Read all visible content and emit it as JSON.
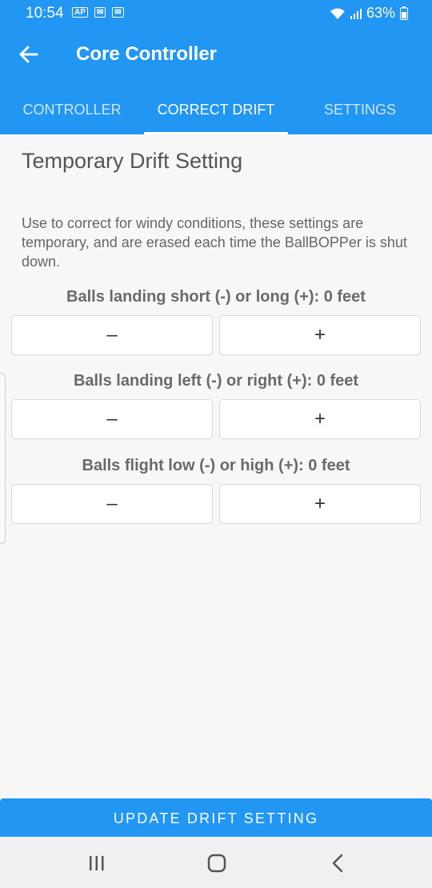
{
  "status": {
    "time": "10:54",
    "notifications": [
      "AP",
      "✉",
      "✉"
    ],
    "battery": "63%"
  },
  "appbar": {
    "title": "Core Controller"
  },
  "tabs": [
    {
      "label": "CONTROLLER",
      "active": false
    },
    {
      "label": "CORRECT DRIFT",
      "active": true
    },
    {
      "label": "SETTINGS",
      "active": false
    }
  ],
  "content": {
    "heading": "Temporary Drift Setting",
    "description": "Use to correct for windy conditions, these settings are temporary, and are erased each time the BallBOPPer is shut down.",
    "rows": [
      {
        "label": "Balls landing short (-) or long (+): 0 feet",
        "minus": "–",
        "plus": "+"
      },
      {
        "label": "Balls landing left (-) or right (+): 0 feet",
        "minus": "–",
        "plus": "+"
      },
      {
        "label": "Balls flight low (-) or high (+): 0 feet",
        "minus": "–",
        "plus": "+"
      }
    ]
  },
  "update_button": "UPDATE DRIFT SETTING",
  "colors": {
    "primary": "#2196f3",
    "background": "#f7f7f7"
  }
}
